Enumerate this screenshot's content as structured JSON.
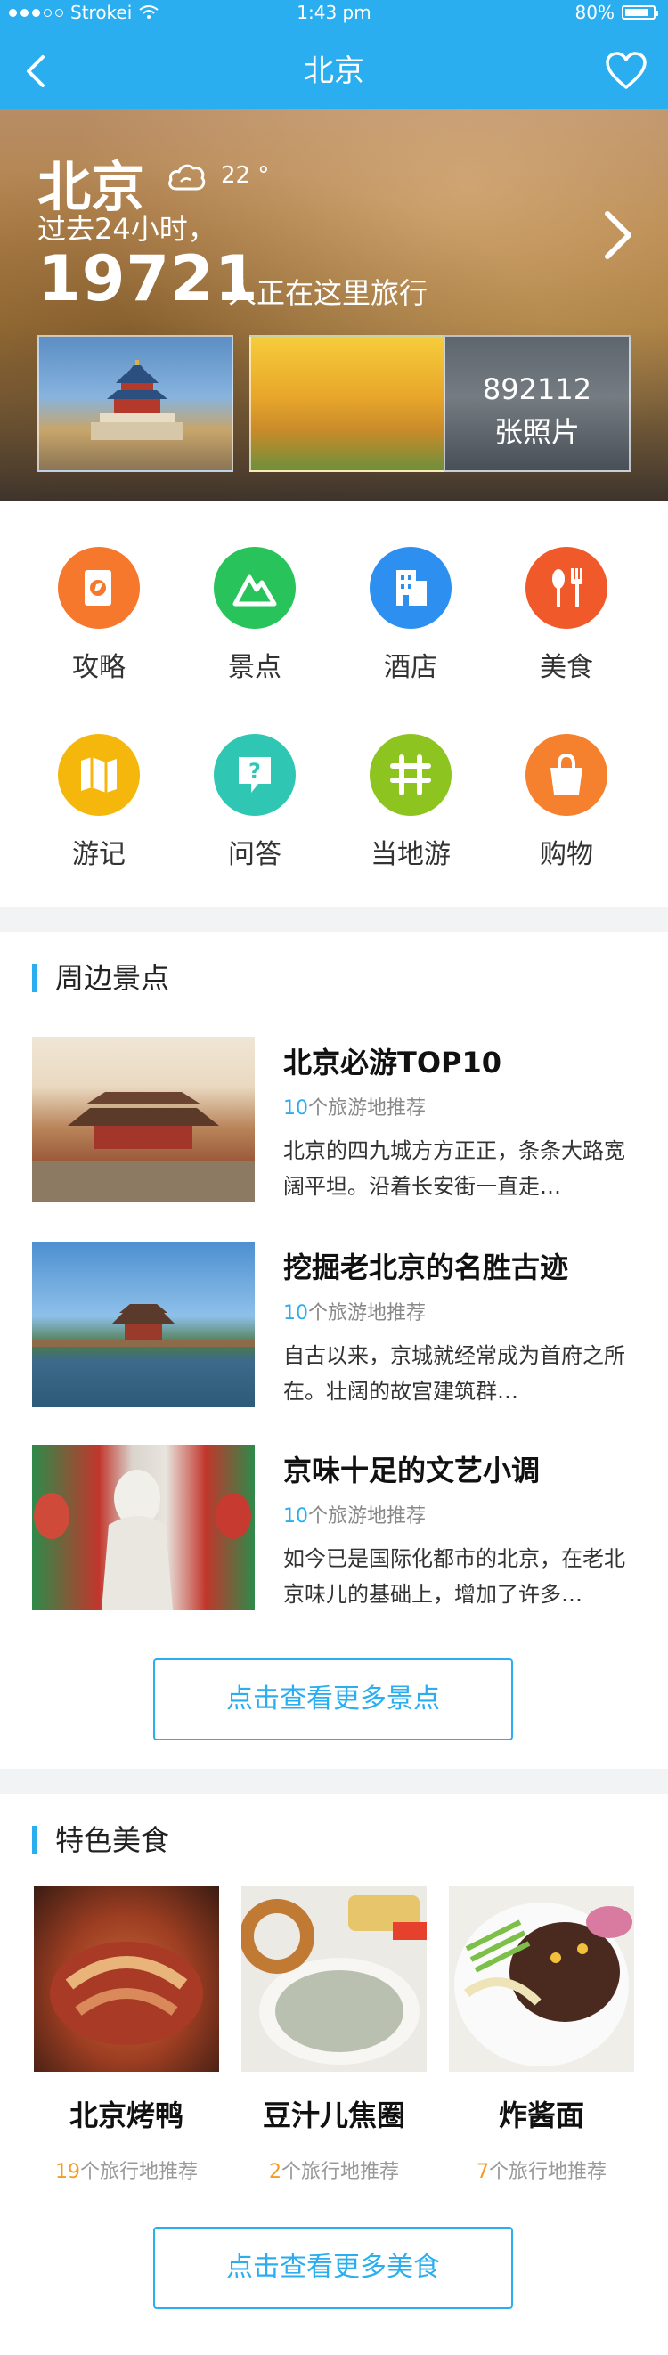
{
  "status": {
    "carrier": "Strokei",
    "time": "1:43 pm",
    "battery": "80%"
  },
  "nav": {
    "title": "北京"
  },
  "hero": {
    "city": "北京",
    "temp": "22 °",
    "past": "过去24小时，",
    "count": "19721",
    "count_suffix": "人正在这里旅行",
    "photos_count": "892112",
    "photos_label": "张照片"
  },
  "categories": [
    {
      "label": "攻略",
      "icon": "guide-icon",
      "color": "#f5782c"
    },
    {
      "label": "景点",
      "icon": "mountain-icon",
      "color": "#28c45b"
    },
    {
      "label": "酒店",
      "icon": "hotel-icon",
      "color": "#2d8ff0"
    },
    {
      "label": "美食",
      "icon": "food-icon",
      "color": "#f05a2b"
    },
    {
      "label": "游记",
      "icon": "map-icon",
      "color": "#f6b70d"
    },
    {
      "label": "问答",
      "icon": "question-icon",
      "color": "#2fc7b3"
    },
    {
      "label": "当地游",
      "icon": "local-tour-icon",
      "color": "#8dc41f"
    },
    {
      "label": "购物",
      "icon": "shopping-bag-icon",
      "color": "#f5802d"
    }
  ],
  "nearby": {
    "title": "周边景点",
    "items": [
      {
        "title": "北京必游TOP10",
        "count": "10",
        "count_suffix": "个旅游地推荐",
        "desc": "北京的四九城方方正正，条条大路宽阔平坦。沿着长安街一直走…"
      },
      {
        "title": "挖掘老北京的名胜古迹",
        "count": "10",
        "count_suffix": "个旅游地推荐",
        "desc": "自古以来，京城就经常成为首府之所在。壮阔的故宫建筑群…"
      },
      {
        "title": "京味十足的文艺小调",
        "count": "10",
        "count_suffix": "个旅游地推荐",
        "desc": "如今已是国际化都市的北京，在老北京味儿的基础上，增加了许多…"
      }
    ],
    "more_button": "点击查看更多景点"
  },
  "food": {
    "title": "特色美食",
    "items": [
      {
        "name": "北京烤鸭",
        "count": "19",
        "count_suffix": "个旅行地推荐"
      },
      {
        "name": "豆汁儿焦圈",
        "count": "2",
        "count_suffix": "个旅行地推荐"
      },
      {
        "name": "炸酱面",
        "count": "7",
        "count_suffix": "个旅行地推荐"
      }
    ],
    "more_button": "点击查看更多美食"
  }
}
